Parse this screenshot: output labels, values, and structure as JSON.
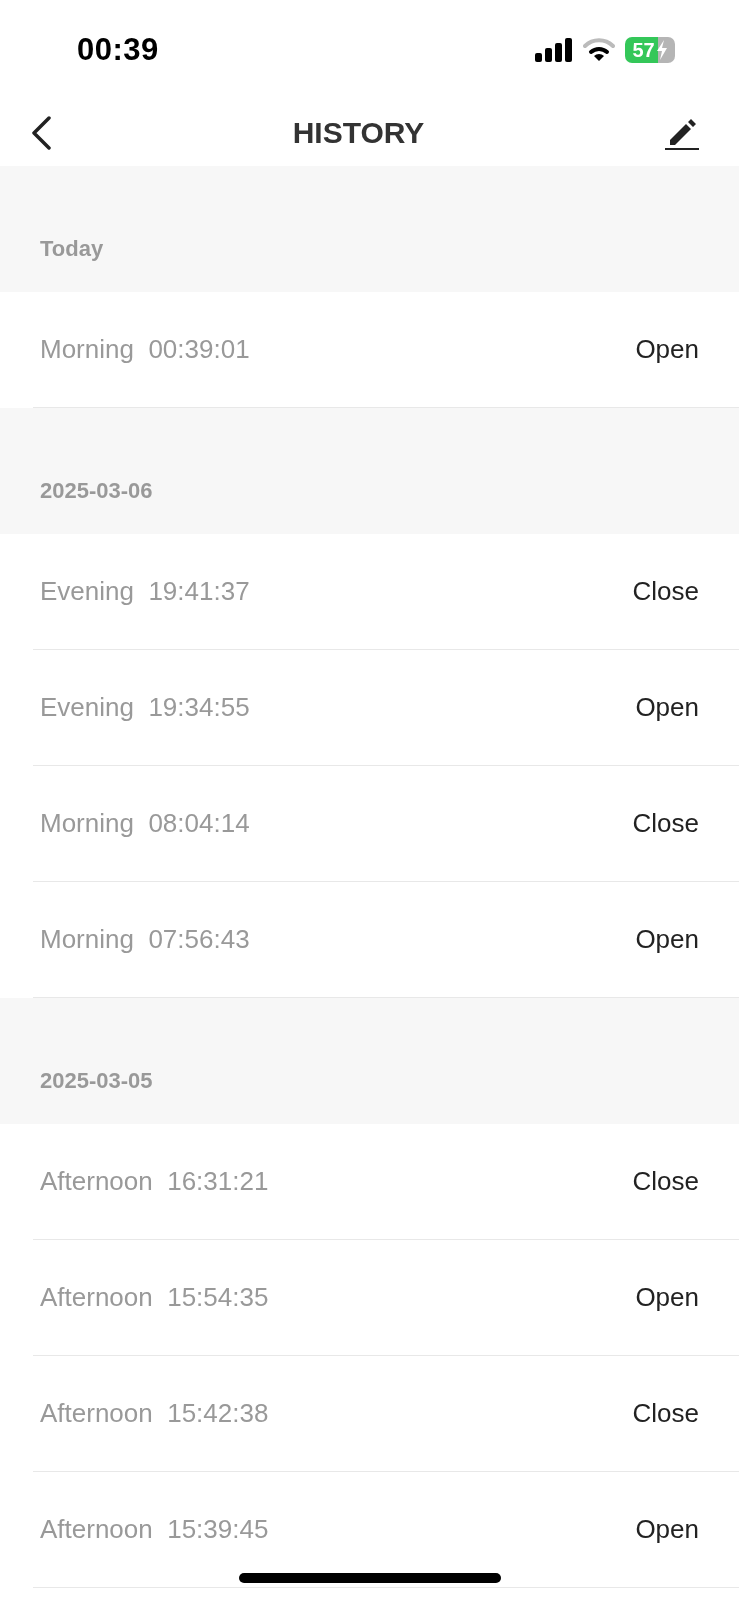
{
  "status_bar": {
    "time": "00:39",
    "battery_percent": "57",
    "charging": true
  },
  "header": {
    "title": "HISTORY"
  },
  "sections": [
    {
      "label": "Today",
      "rows": [
        {
          "period": "Morning",
          "time": "00:39:01",
          "action": "Open"
        }
      ]
    },
    {
      "label": "2025-03-06",
      "rows": [
        {
          "period": "Evening",
          "time": "19:41:37",
          "action": "Close"
        },
        {
          "period": "Evening",
          "time": "19:34:55",
          "action": "Open"
        },
        {
          "period": "Morning",
          "time": "08:04:14",
          "action": "Close"
        },
        {
          "period": "Morning",
          "time": "07:56:43",
          "action": "Open"
        }
      ]
    },
    {
      "label": "2025-03-05",
      "rows": [
        {
          "period": "Afternoon",
          "time": "16:31:21",
          "action": "Close"
        },
        {
          "period": "Afternoon",
          "time": "15:54:35",
          "action": "Open"
        },
        {
          "period": "Afternoon",
          "time": "15:42:38",
          "action": "Close"
        },
        {
          "period": "Afternoon",
          "time": "15:39:45",
          "action": "Open"
        }
      ]
    }
  ]
}
